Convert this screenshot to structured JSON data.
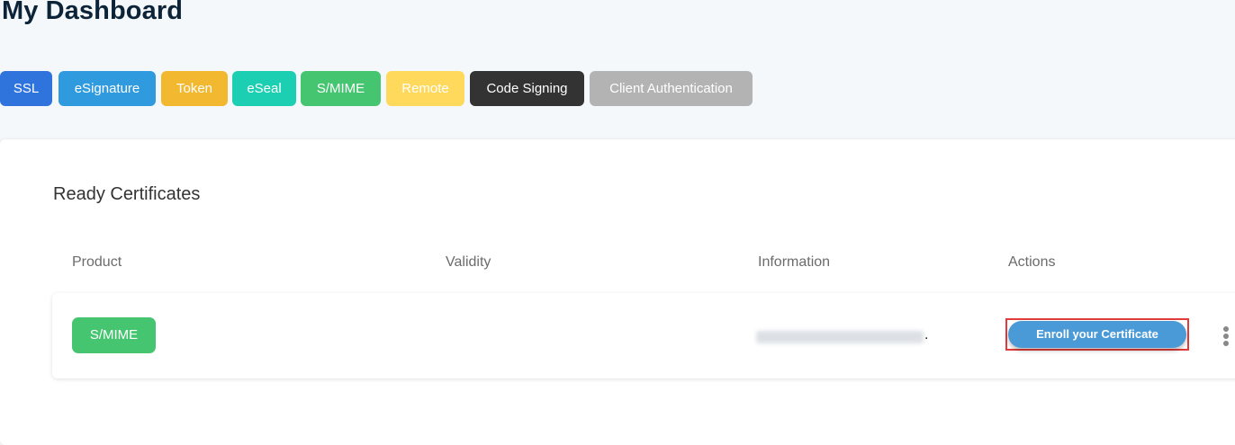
{
  "page": {
    "title": "My Dashboard"
  },
  "filters": [
    {
      "label": "SSL",
      "color": "#2f73dd"
    },
    {
      "label": "eSignature",
      "color": "#2f9bde"
    },
    {
      "label": "Token",
      "color": "#f2b830"
    },
    {
      "label": "eSeal",
      "color": "#1dcfb2"
    },
    {
      "label": "S/MIME",
      "color": "#45c56f"
    },
    {
      "label": "Remote",
      "color": "#ffd95c"
    },
    {
      "label": "Code Signing",
      "color": "#333333"
    },
    {
      "label": "Client Authentication",
      "color": "#b3b3b3"
    }
  ],
  "section": {
    "title": "Ready Certificates"
  },
  "table": {
    "columns": [
      "Product",
      "Validity",
      "Information",
      "Actions"
    ],
    "rows": [
      {
        "product": "S/MIME",
        "validity": "",
        "information_suffix": ".",
        "action_label": "Enroll your Certificate"
      }
    ]
  },
  "icons": {
    "more": "kebab-menu-icon"
  }
}
